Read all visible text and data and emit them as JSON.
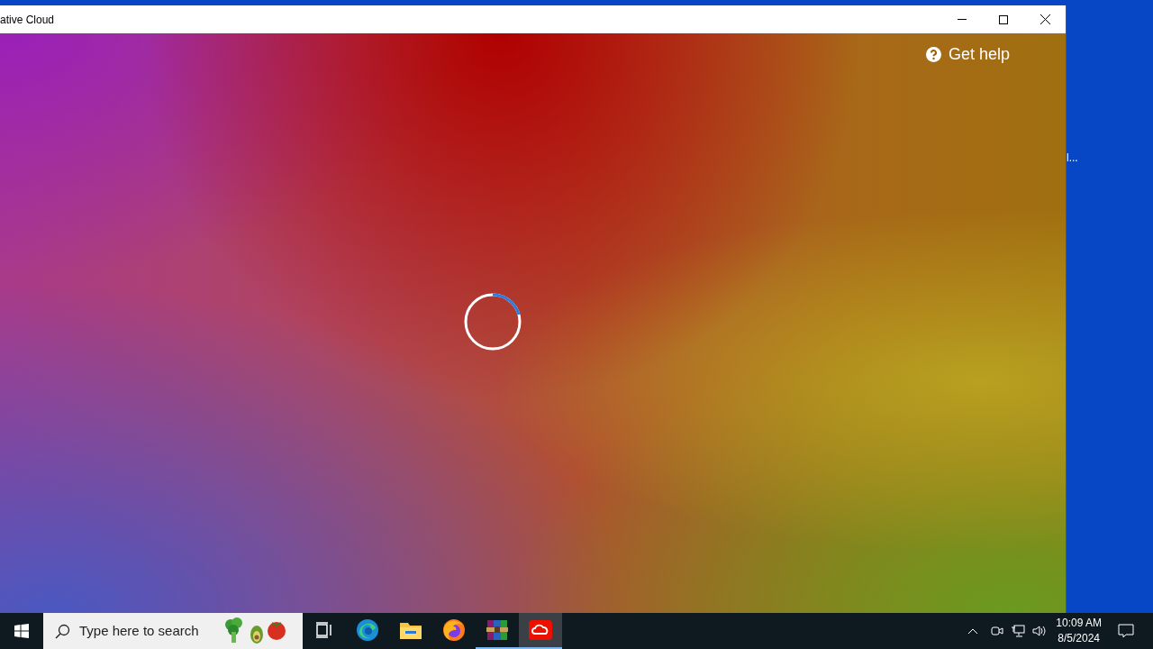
{
  "window": {
    "title": "ative Cloud"
  },
  "content": {
    "help_link": "Get help",
    "loading": true
  },
  "desktop": {
    "label_fragment": "l..."
  },
  "taskbar": {
    "search": {
      "placeholder": "Type here to search"
    },
    "apps": [
      {
        "kind": "taskview",
        "running": false,
        "selected": false
      },
      {
        "kind": "edge",
        "running": false,
        "selected": false
      },
      {
        "kind": "explorer",
        "running": false,
        "selected": false
      },
      {
        "kind": "firefox",
        "running": false,
        "selected": false
      },
      {
        "kind": "winrar",
        "running": true,
        "selected": false
      },
      {
        "kind": "creativecloud",
        "running": true,
        "selected": true
      }
    ],
    "time": "10:09 AM",
    "date": "8/5/2024"
  }
}
